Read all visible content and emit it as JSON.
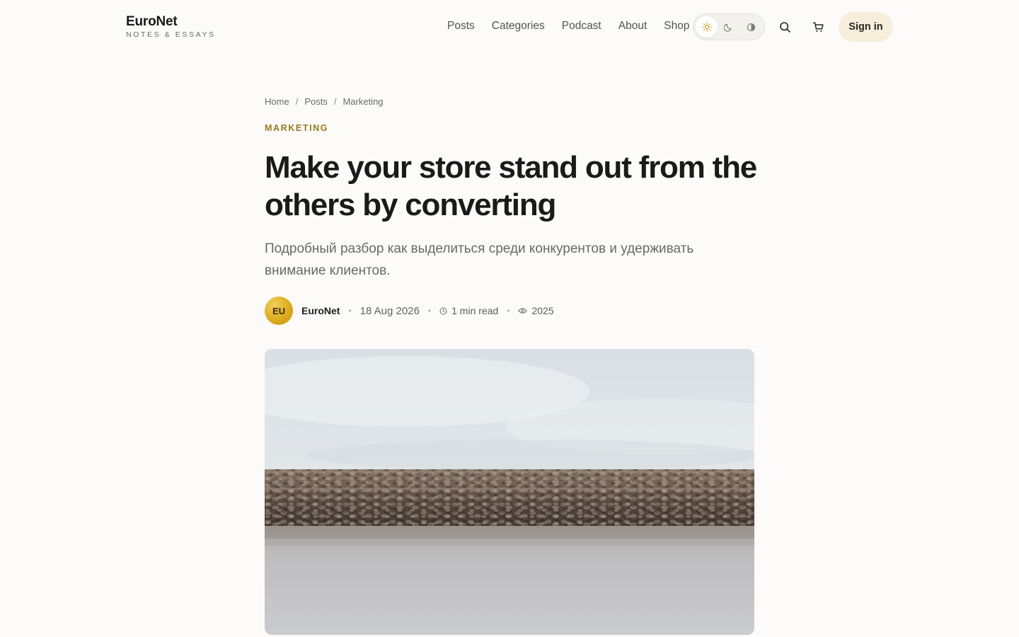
{
  "brand": {
    "name": "EuroNet",
    "tagline": "NOTES & ESSAYS"
  },
  "nav": {
    "items": [
      "Posts",
      "Categories",
      "Podcast",
      "About",
      "Shop"
    ]
  },
  "theme": {
    "options": [
      "sun-icon",
      "moon-icon",
      "contrast-icon"
    ],
    "active": "sun-icon"
  },
  "actions": {
    "signin_label": "Sign in",
    "search_icon": "search-icon",
    "cart_icon": "cart-icon"
  },
  "breadcrumb": {
    "items": [
      "Home",
      "Posts",
      "Marketing"
    ],
    "separator": "/"
  },
  "article": {
    "category": "MARKETING",
    "title": "Make your store stand out from the others by converting",
    "subtitle": "Подробный разбор как выделиться среди конкурентов и удерживать внимание клиентов.",
    "author_initials": "EU",
    "author": "EuroNet",
    "date": "18 Aug 2026",
    "read_time": "1 min read",
    "views": "2025"
  },
  "colors": {
    "accent": "#9a7a1e",
    "signin_bg": "#f6eedb",
    "avatar": "#d9a91a",
    "background": "#fcfbf9"
  }
}
